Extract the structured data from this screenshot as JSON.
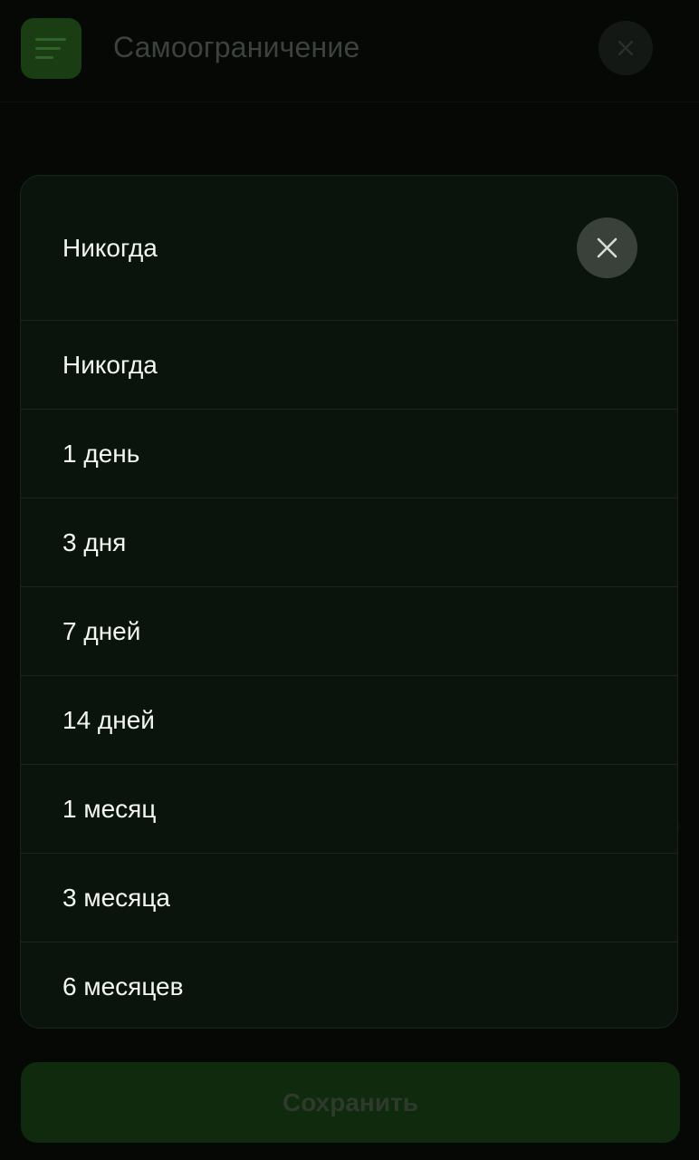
{
  "header": {
    "title": "Самоограничение",
    "menu_icon": "menu-icon",
    "close_icon": "close-icon"
  },
  "dropdown": {
    "selected_value": "Никогда",
    "close_icon": "close-icon",
    "options": [
      {
        "label": "Никогда"
      },
      {
        "label": "1 день"
      },
      {
        "label": "3 дня"
      },
      {
        "label": "7 дней"
      },
      {
        "label": "14 дней"
      },
      {
        "label": "1 месяц"
      },
      {
        "label": "3 месяца"
      },
      {
        "label": "6 месяцев"
      }
    ]
  },
  "footer": {
    "save_label": "Сохранить"
  },
  "colors": {
    "background": "#050805",
    "sheet": "#0b140c",
    "accent_green": "#1a3d14",
    "text": "#f4f6f4"
  }
}
